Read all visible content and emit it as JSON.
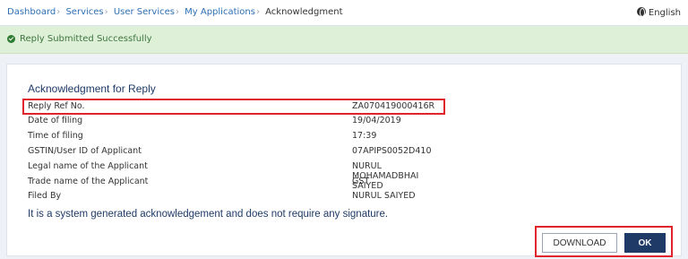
{
  "breadcrumb": {
    "items": [
      "Dashboard",
      "Services",
      "User Services",
      "My Applications"
    ],
    "current": "Acknowledgment"
  },
  "language": {
    "label": "English",
    "icon": "globe-icon"
  },
  "alert": {
    "message": "Reply Submitted Successfully",
    "icon": "check-circle-icon",
    "color": "#dff0d8"
  },
  "acknowledgment": {
    "title": "Acknowledgment for Reply",
    "rows": [
      {
        "label": "Reply Ref No.",
        "value": "ZA070419000416R"
      },
      {
        "label": "Date of filing",
        "value": "19/04/2019"
      },
      {
        "label": "Time of filing",
        "value": "17:39"
      },
      {
        "label": "GSTIN/User ID of Applicant",
        "value": "07APIPS0052D410"
      },
      {
        "label": "Legal name of the Applicant",
        "value": "NURUL MOHAMADBHAI SAIYED"
      },
      {
        "label": "Trade name of the Applicant",
        "value": "GST"
      },
      {
        "label": "Filed By",
        "value": "NURUL SAIYED"
      }
    ],
    "note": "It is a system generated acknowledgement and does not require any signature."
  },
  "buttons": {
    "download": "DOWNLOAD",
    "ok": "OK"
  },
  "colors": {
    "primary": "#1f3a67",
    "highlight": "#e0242b",
    "link": "#2d6fb3"
  }
}
